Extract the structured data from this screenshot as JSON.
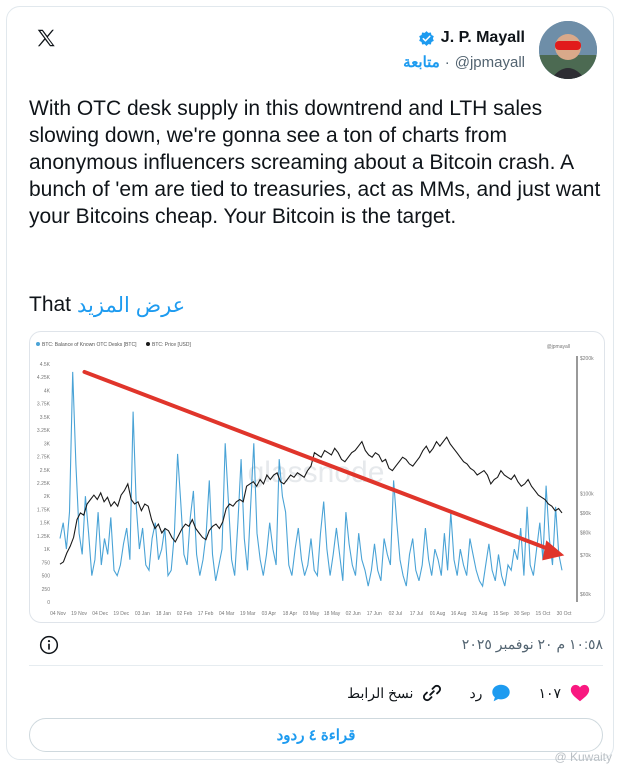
{
  "post": {
    "author_name": "J. P. Mayall",
    "handle": "@jpmayall",
    "follow_label": "متابعة",
    "separator": "·",
    "text": "With OTC desk supply in this downtrend and LTH sales slowing down, we're gonna see a ton of charts from anonymous influencers screaming about a Bitcoin crash. A bunch of 'em are tied to treasuries, act as MMs, and just want your Bitcoins cheap. Your Bitcoin is the target.",
    "that_word": "That",
    "show_more": "عرض المزيد",
    "timestamp": "١٠:٥٨ م ٢٠ نوفمبر ٢٠٢٥",
    "likes_count": "١٠٧",
    "reply_label": "رد",
    "copy_link_label": "نسخ الرابط",
    "read_replies": "قراءة ٤ ردود"
  },
  "colors": {
    "brand_blue": "#1d9bf0",
    "like_pink": "#f91880",
    "otc_series": "#4aa3d6",
    "price_series": "#1a1a1a",
    "trend_arrow": "#e0352b"
  },
  "icons": {
    "logo": "x-logo-icon",
    "verified": "verified-badge-icon",
    "info": "info-icon",
    "like": "heart-icon",
    "reply": "speech-bubble-icon",
    "copy": "link-icon"
  },
  "chart_data": {
    "type": "line",
    "legend": [
      "BTC: Balance of Known OTC Desks [BTC]",
      "BTC: Price [USD]"
    ],
    "source_tag": "@jpmayall",
    "watermark": "glassnode",
    "x_ticks": [
      "04 Nov",
      "19 Nov",
      "04 Dec",
      "19 Dec",
      "03 Jan",
      "18 Jan",
      "02 Feb",
      "17 Feb",
      "04 Mar",
      "19 Mar",
      "03 Apr",
      "18 Apr",
      "03 May",
      "18 May",
      "02 Jun",
      "17 Jun",
      "02 Jul",
      "17 Jul",
      "01 Aug",
      "16 Aug",
      "31 Aug",
      "15 Sep",
      "30 Sep",
      "15 Oct",
      "30 Oct"
    ],
    "y_left_ticks": [
      "4.5K",
      "4.25K",
      "4K",
      "3.75K",
      "3.5K",
      "3.25K",
      "3K",
      "2.75K",
      "2.5K",
      "2.25K",
      "2K",
      "1.75K",
      "1.5K",
      "1.25K",
      "1K",
      "750",
      "500",
      "250",
      "0"
    ],
    "y_right_ticks": [
      "$200k",
      "$100k",
      "$90k",
      "$80k",
      "$70k",
      "$60k"
    ],
    "ylim_left": [
      0,
      4500
    ],
    "series": [
      {
        "name": "BTC: Balance of Known OTC Desks [BTC]",
        "axis": "left",
        "values": [
          1200,
          1500,
          1000,
          1700,
          4350,
          2600,
          1300,
          900,
          2000,
          1300,
          500,
          800,
          1700,
          700,
          1200,
          900,
          1600,
          600,
          500,
          700,
          1100,
          1400,
          800,
          3600,
          1800,
          1000,
          1400,
          700,
          600,
          1200,
          1500,
          800,
          1000,
          1400,
          500,
          600,
          1300,
          2800,
          1900,
          900,
          700,
          1600,
          2100,
          900,
          500,
          800,
          1300,
          2300,
          900,
          400,
          700,
          1000,
          3000,
          1900,
          800,
          500,
          1500,
          2700,
          1200,
          600,
          1800,
          3000,
          1300,
          800,
          500,
          900,
          1500,
          1000,
          700,
          2700,
          2000,
          1700,
          700,
          500,
          1000,
          1400,
          800,
          500,
          700,
          1200,
          600,
          500,
          1300,
          1900,
          1000,
          500,
          900,
          1400,
          900,
          400,
          1700,
          1100,
          700,
          500,
          1300,
          800,
          600,
          300,
          600,
          1100,
          600,
          400,
          1200,
          900,
          700,
          2300,
          1500,
          800,
          500,
          300,
          900,
          1200,
          600,
          400,
          700,
          1400,
          800,
          500,
          1000,
          800,
          500,
          1300,
          600,
          1700,
          800,
          500,
          1000,
          700,
          500,
          1200,
          900,
          600,
          400,
          300,
          700,
          1100,
          600,
          400,
          900,
          500,
          300,
          700,
          600,
          1000,
          800,
          1400,
          500,
          1800,
          700,
          500,
          1000,
          1500,
          800,
          2200,
          1200,
          700,
          1800,
          900,
          600
        ]
      },
      {
        "name": "BTC: Price [USD]",
        "axis": "right",
        "values": [
          68000,
          69000,
          73000,
          76000,
          80000,
          88000,
          91000,
          90000,
          95000,
          97000,
          99000,
          97000,
          100000,
          96000,
          98000,
          94000,
          96000,
          94000,
          99000,
          101000,
          104000,
          97000,
          95000,
          96000,
          92000,
          95000,
          94000,
          88000,
          84000,
          86000,
          82000,
          84000,
          83000,
          80000,
          78000,
          81000,
          84000,
          86000,
          85000,
          88000,
          84000,
          82000,
          80000,
          79000,
          83000,
          85000,
          86000,
          84000,
          87000,
          93000,
          95000,
          94000,
          96000,
          97000,
          96000,
          103000,
          104000,
          105000,
          103000,
          106000,
          104000,
          108000,
          106000,
          108000,
          109000,
          105000,
          104000,
          106000,
          108000,
          107000,
          109000,
          108000,
          107000,
          110000,
          112000,
          118000,
          117000,
          116000,
          119000,
          118000,
          117000,
          120000,
          118000,
          115000,
          114000,
          116000,
          118000,
          119000,
          121000,
          123000,
          119000,
          117000,
          116000,
          118000,
          117000,
          114000,
          115000,
          111000,
          110000,
          112000,
          114000,
          116000,
          115000,
          113000,
          112000,
          114000,
          116000,
          119000,
          121000,
          118000,
          120000,
          123000,
          121000,
          123000,
          125000,
          122000,
          120000,
          118000,
          116000,
          114000,
          113000,
          111000,
          110000,
          108000,
          109000,
          110000,
          108000,
          104000,
          106000,
          107000,
          110000,
          108000,
          107000,
          106000,
          108000,
          105000,
          103000,
          104000,
          106000,
          103000,
          101000,
          99000,
          98000,
          97000,
          95000,
          94000,
          92000,
          93000,
          91000
        ]
      }
    ],
    "trend_arrow": {
      "from": [
        0.02,
        4350
      ],
      "to": [
        0.97,
        900
      ]
    }
  }
}
